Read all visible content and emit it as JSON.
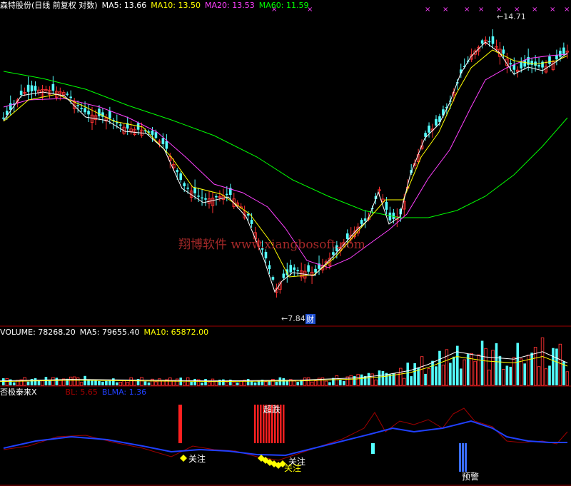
{
  "price_pane": {
    "title": "森特股份(日线 前复权 对数)",
    "ma": [
      {
        "label": "MA5: 13.66",
        "color": "#ffffff"
      },
      {
        "label": "MA10: 13.50",
        "color": "#ffff00"
      },
      {
        "label": "MA20: 13.53",
        "color": "#ff40ff"
      },
      {
        "label": "MA60: 11.59",
        "color": "#00ff00"
      }
    ],
    "high_label": "14.71",
    "low_label": "7.84",
    "low_tag": "财",
    "watermark": "翔博软件  www.xiangbosoft.com",
    "high_value": 14.71,
    "low_value": 7.84
  },
  "volume_pane": {
    "title": "VOLUME: 78268.20",
    "ma": [
      {
        "label": "MA5: 79655.40",
        "color": "#ffffff"
      },
      {
        "label": "MA10: 65872.00",
        "color": "#ffff00"
      }
    ]
  },
  "indicator_pane": {
    "title": "否极泰来X",
    "bl": {
      "label": "BL: 5.65",
      "color": "#a00000"
    },
    "blma": {
      "label": "BLMA: 1.36",
      "color": "#2040ff"
    },
    "tags": [
      "关注",
      "超跌",
      "关注",
      "关注",
      "预警"
    ]
  },
  "colors": {
    "up": "#ff3232",
    "down": "#54ffff",
    "ma5": "#ffffff",
    "ma10": "#ffff00",
    "ma20": "#ff40ff",
    "ma60": "#00ff00",
    "bl": "#a00000",
    "blma": "#2040ff"
  }
}
